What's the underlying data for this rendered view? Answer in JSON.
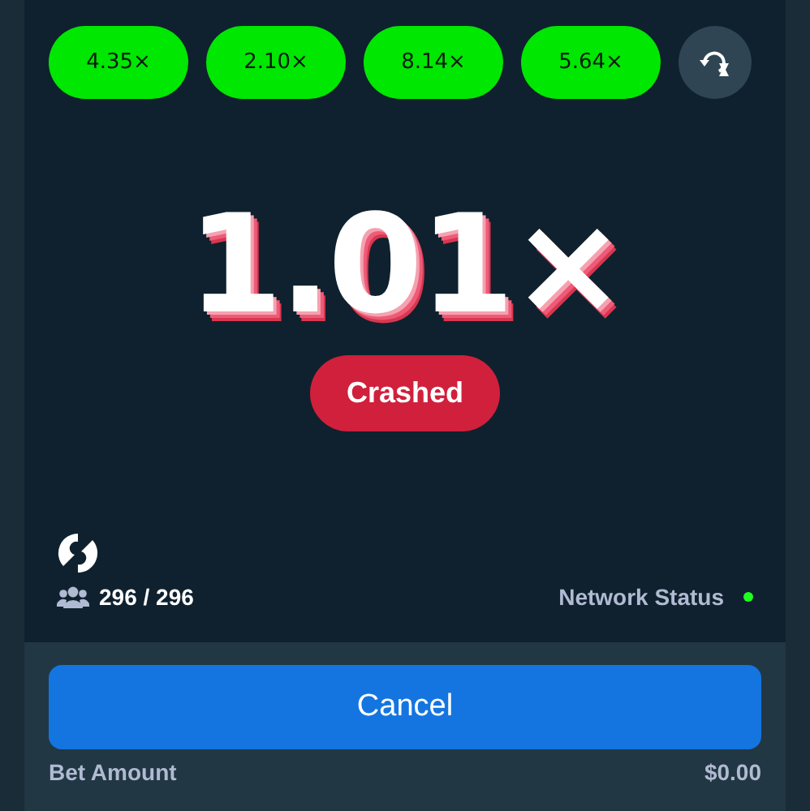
{
  "history": [
    {
      "label": "4.35×",
      "color": "#00e701"
    },
    {
      "label": "2.10×",
      "color": "#00e701"
    },
    {
      "label": "8.14×",
      "color": "#00e701"
    },
    {
      "label": "5.64×",
      "color": "#00e701"
    }
  ],
  "multiplier": "1.01×",
  "status": {
    "label": "Crashed",
    "kind": "crashed"
  },
  "players": "296 / 296",
  "network": {
    "label": "Network Status",
    "online": true
  },
  "action_button": "Cancel",
  "bet_amount": {
    "label": "Bet Amount",
    "value": "$0.00"
  }
}
